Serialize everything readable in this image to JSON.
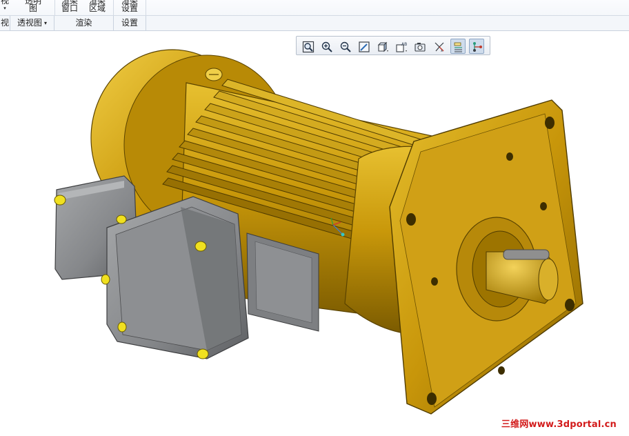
{
  "ribbon": {
    "buttons": [
      {
        "line1": "视",
        "line2": "▾"
      },
      {
        "line1": "透明",
        "line2": "图"
      },
      {
        "line1": "渲染",
        "line2": "窗口"
      },
      {
        "line1": "渲染",
        "line2": "区域"
      },
      {
        "line1": "渲染",
        "line2": "设置"
      }
    ],
    "groups": [
      {
        "label": "视"
      },
      {
        "label": "透视图",
        "dropdown": "▾"
      },
      {
        "label": "渲染"
      },
      {
        "label": "设置"
      }
    ]
  },
  "graphics_toolbar": {
    "buttons": [
      {
        "icon": "refit-icon"
      },
      {
        "icon": "zoom-in-icon"
      },
      {
        "icon": "zoom-out-icon"
      },
      {
        "icon": "repaint-icon"
      },
      {
        "icon": "display-style-icon"
      },
      {
        "icon": "saved-orientations-icon"
      },
      {
        "icon": "view-manager-icon"
      },
      {
        "icon": "datum-display-icon"
      },
      {
        "icon": "annotation-display-icon",
        "active": true
      },
      {
        "icon": "spin-center-icon",
        "active": true
      }
    ]
  },
  "watermark": {
    "text": "三维网www.3dportal.cn"
  },
  "colors": {
    "motor_gold": "#c9980a",
    "motor_dark": "#7a5a00",
    "motor_light": "#e8c33a",
    "junction_box": "#8a8c8e",
    "watermark": "#d21a1a"
  }
}
